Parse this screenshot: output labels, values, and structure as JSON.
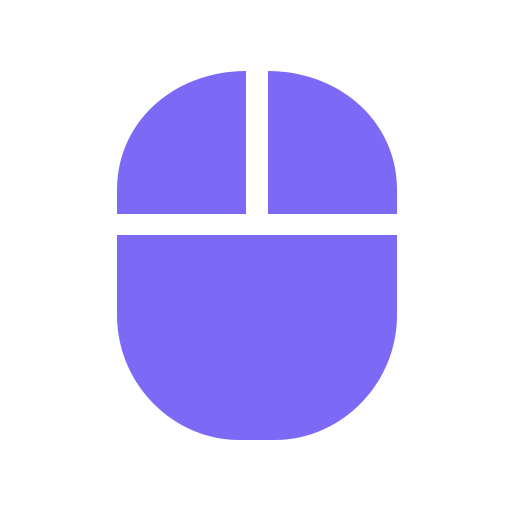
{
  "icon": {
    "name": "mouse-icon",
    "color": "#7c6af6",
    "background": "#ffffff"
  }
}
